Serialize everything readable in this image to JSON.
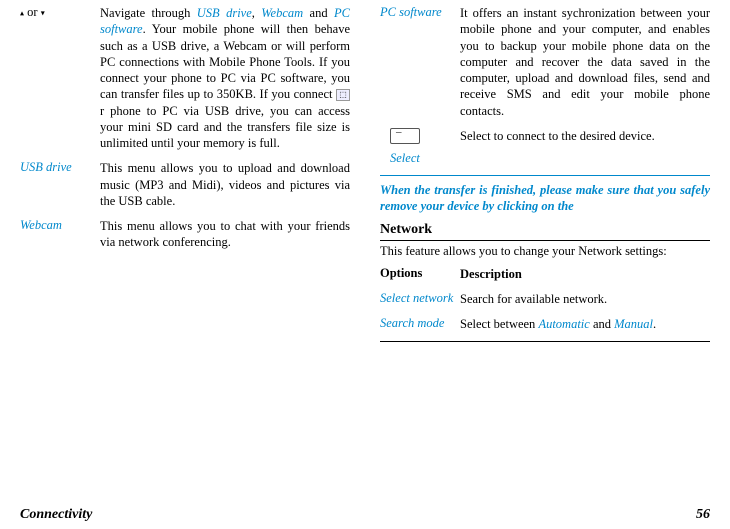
{
  "leftCol": {
    "r1": {
      "arrowUp": "▴",
      "or": " or ",
      "arrowDown": "▾",
      "desc_a": "Navigate through ",
      "usb": "USB drive",
      "comma": ", ",
      "webcam": "Webcam",
      "and": " and ",
      "pcsoft": "PC software",
      "desc_b": ". Your mobile phone will then behave such as a USB drive, a Webcam or will perform PC connections with Mobile Phone Tools. If you connect your phone to PC via PC software, you can transfer files up to 350KB. If you connect ",
      "desc_c": " r phone to PC via USB drive, you can access your mini SD card and the transfers file size is unlimited until your memory is full."
    },
    "r2": {
      "label": "USB drive",
      "desc": "This menu allows you to upload and download music (MP3 and Midi), videos and pictures via the USB cable."
    },
    "r3": {
      "label": "Webcam",
      "desc": "This menu allows you to chat with your friends via network conferencing."
    }
  },
  "rightCol": {
    "r1": {
      "label": "PC software",
      "desc": "It offers an instant sychronization between your mobile phone and your computer, and enables you to backup your mobile phone data on the computer and recover the data saved in the computer, upload and download files, send and receive SMS and edit your mobile phone contacts."
    },
    "r2": {
      "label": "Select",
      "desc": "Select to connect to the desired device."
    },
    "note": "When the transfer is finished, please make sure that you safely remove your device by clicking on the",
    "netTitle": "Network",
    "netIntro": "This feature allows you to change your Network settings:",
    "optsHdr1": "Options",
    "optsHdr2": "Description",
    "opt1": {
      "label": "Select network",
      "desc": "Search for available network."
    },
    "opt2": {
      "label": "Search mode",
      "desc_a": "Select between ",
      "auto": "Automatic",
      "and": " and ",
      "man": "Manual",
      "dot": "."
    }
  },
  "footer": {
    "title": "Connectivity",
    "pageNum": "56"
  }
}
